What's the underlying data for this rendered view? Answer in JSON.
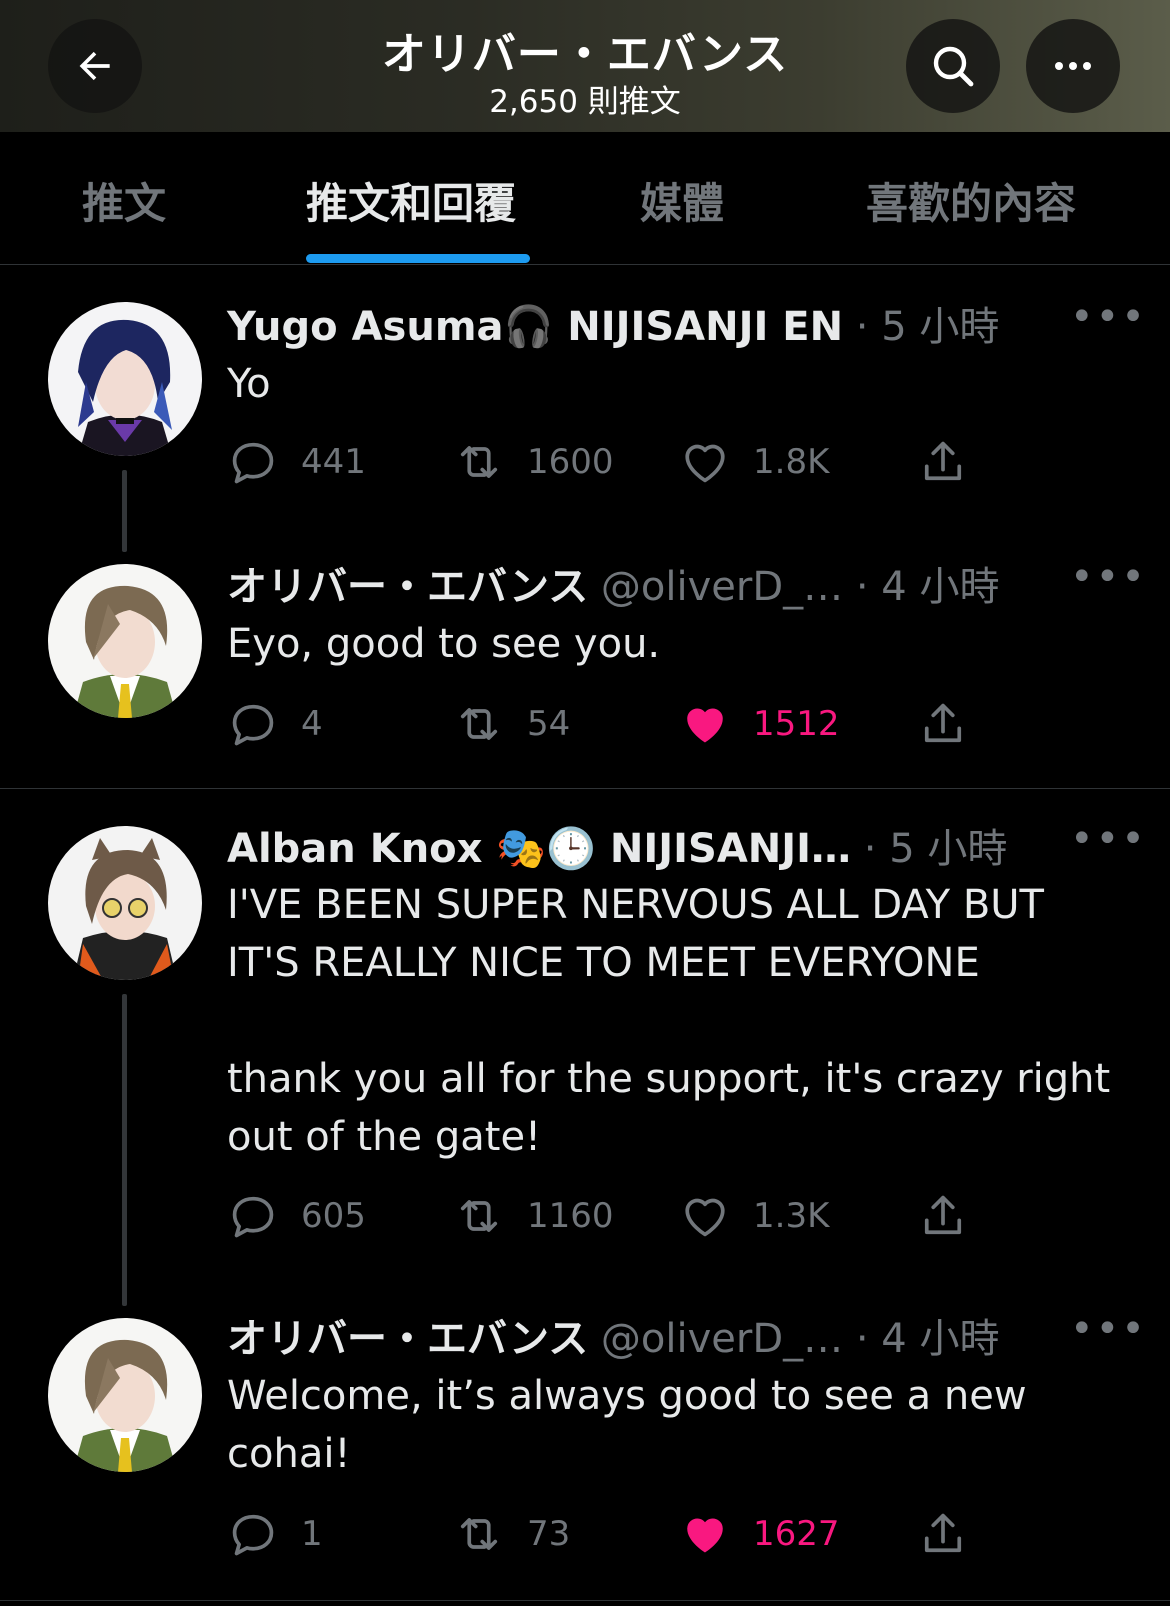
{
  "header": {
    "title": "オリバー・エバンス",
    "tweet_count": "2,650 則推文",
    "icons": [
      "back-arrow-icon",
      "search-icon",
      "more-icon"
    ]
  },
  "tabs": [
    {
      "label": "推文",
      "active": false
    },
    {
      "label": "推文和回覆",
      "active": true
    },
    {
      "label": "媒體",
      "active": false
    },
    {
      "label": "喜歡的內容",
      "active": false
    }
  ],
  "colors": {
    "accent": "#1d9bf0",
    "like": "#f91880",
    "muted": "#71767b"
  },
  "tweets": [
    {
      "name": "Yugo Asuma🎧 NIJISANJI EN",
      "meta": " · 5 小時",
      "text": "Yo",
      "replies": "441",
      "retweets": "1600",
      "likes": "1.8K",
      "liked": false
    },
    {
      "name": "オリバー・エバンス",
      "meta": " @oliverD_… · 4 小時",
      "text": "Eyo, good to see you.",
      "replies": "4",
      "retweets": "54",
      "likes": "1512",
      "liked": true
    },
    {
      "name": "Alban Knox 🎭🕒 NIJISANJI…",
      "meta": " · 5 小時",
      "text": "I'VE BEEN SUPER NERVOUS ALL DAY BUT IT'S REALLY NICE TO MEET EVERYONE\n\nthank you all for the support, it's crazy right out of the gate!",
      "replies": "605",
      "retweets": "1160",
      "likes": "1.3K",
      "liked": false
    },
    {
      "name": "オリバー・エバンス",
      "meta": " @oliverD_… · 4 小時",
      "text": "Welcome, it’s always good to see a new cohai!",
      "replies": "1",
      "retweets": "73",
      "likes": "1627",
      "liked": true
    }
  ]
}
